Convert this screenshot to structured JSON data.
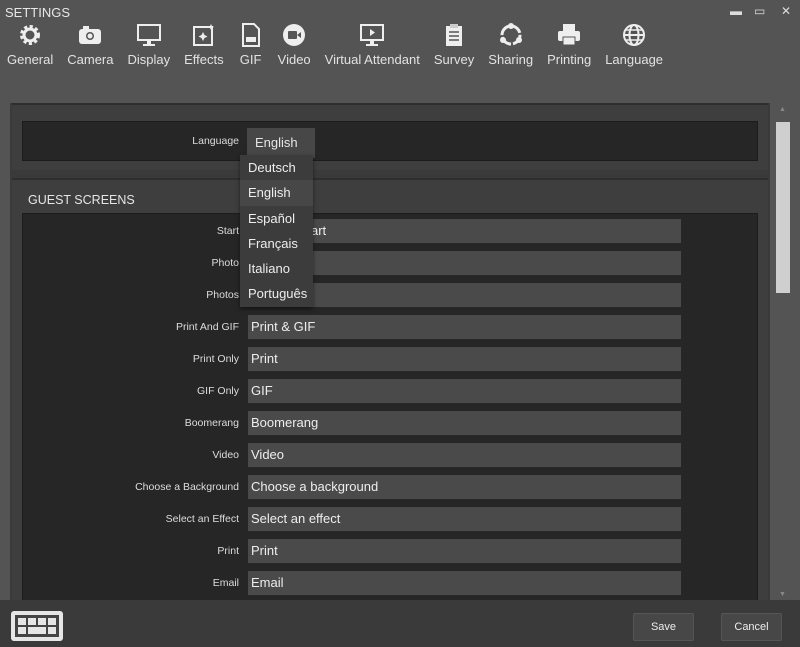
{
  "window": {
    "title": "SETTINGS",
    "minimize": "▬",
    "maximize": "▭",
    "close": "✕"
  },
  "tabs": [
    {
      "label": "General",
      "icon": "gear-icon"
    },
    {
      "label": "Camera",
      "icon": "camera-icon"
    },
    {
      "label": "Display",
      "icon": "monitor-icon"
    },
    {
      "label": "Effects",
      "icon": "effects-icon"
    },
    {
      "label": "GIF",
      "icon": "gif-file-icon"
    },
    {
      "label": "Video",
      "icon": "video-icon"
    },
    {
      "label": "Virtual Attendant",
      "icon": "virtual-attendant-icon"
    },
    {
      "label": "Survey",
      "icon": "clipboard-icon"
    },
    {
      "label": "Sharing",
      "icon": "sharing-icon"
    },
    {
      "label": "Printing",
      "icon": "printer-icon"
    },
    {
      "label": "Language",
      "icon": "globe-icon"
    }
  ],
  "language": {
    "label": "Language",
    "selected": "English",
    "options": [
      "Deutsch",
      "English",
      "Español",
      "Français",
      "Italiano",
      "Português"
    ]
  },
  "guest_screens": {
    "title": "GUEST SCREENS",
    "rows": [
      {
        "label": "Start",
        "value": "art"
      },
      {
        "label": "Photo",
        "value": ""
      },
      {
        "label": "Photos",
        "value": ""
      },
      {
        "label": "Print And GIF",
        "value": "Print & GIF"
      },
      {
        "label": "Print Only",
        "value": "Print"
      },
      {
        "label": "GIF Only",
        "value": "GIF"
      },
      {
        "label": "Boomerang",
        "value": "Boomerang"
      },
      {
        "label": "Video",
        "value": "Video"
      },
      {
        "label": "Choose a Background",
        "value": "Choose a background"
      },
      {
        "label": "Select an Effect",
        "value": "Select an effect"
      },
      {
        "label": "Print",
        "value": "Print"
      },
      {
        "label": "Email",
        "value": "Email"
      }
    ]
  },
  "footer": {
    "save": "Save",
    "cancel": "Cancel",
    "keyboard_icon": "keyboard-icon"
  }
}
